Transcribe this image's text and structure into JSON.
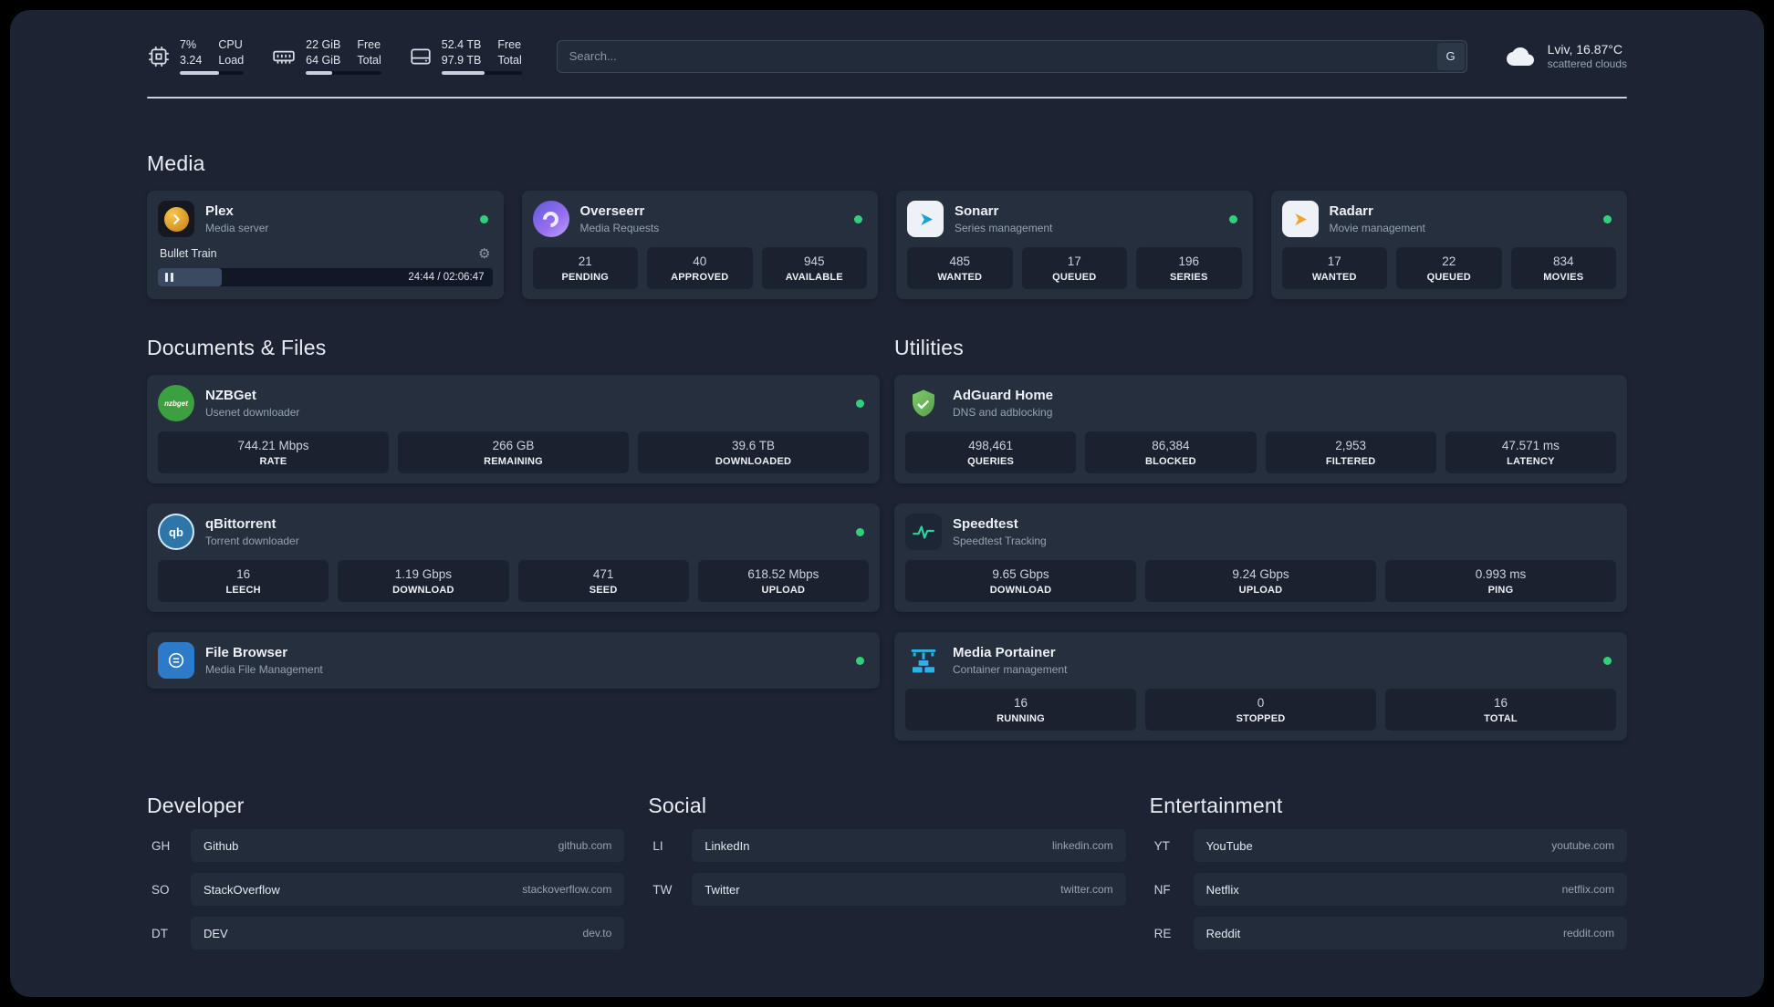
{
  "colors": {
    "status_green": "#31d07c",
    "adguard_green": "#67b279",
    "portainer_blue": "#2fb0e8",
    "background": "#1c2433",
    "card": "#262f3e"
  },
  "header": {
    "cpu": {
      "icon": "cpu-chip-icon",
      "value1": "7%",
      "label1": "CPU",
      "value2": "3.24",
      "label2": "Load",
      "bar_percent": 62
    },
    "memory": {
      "icon": "memory-icon",
      "value1": "22 GiB",
      "label1": "Free",
      "value2": "64 GiB",
      "label2": "Total",
      "bar_percent": 35
    },
    "disk": {
      "icon": "disk-icon",
      "value1": "52.4 TB",
      "label1": "Free",
      "value2": "97.9 TB",
      "label2": "Total",
      "bar_percent": 54
    },
    "search": {
      "placeholder": "Search...",
      "button_label": "G"
    },
    "weather": {
      "icon": "cloud-icon",
      "location": "Lviv, 16.87°C",
      "condition": "scattered clouds"
    }
  },
  "media": {
    "title": "Media",
    "services": [
      {
        "name": "Plex",
        "subtitle": "Media server",
        "icon": "plex-icon",
        "status": "online",
        "now_playing": {
          "title": "Bullet Train",
          "time": "24:44 / 02:06:47",
          "progress_percent": 19,
          "state": "paused"
        }
      },
      {
        "name": "Overseerr",
        "subtitle": "Media Requests",
        "icon": "overseerr-icon",
        "status": "online",
        "stats": [
          {
            "value": "21",
            "label": "PENDING"
          },
          {
            "value": "40",
            "label": "APPROVED"
          },
          {
            "value": "945",
            "label": "AVAILABLE"
          }
        ]
      },
      {
        "name": "Sonarr",
        "subtitle": "Series management",
        "icon": "sonarr-icon",
        "status": "online",
        "stats": [
          {
            "value": "485",
            "label": "WANTED"
          },
          {
            "value": "17",
            "label": "QUEUED"
          },
          {
            "value": "196",
            "label": "SERIES"
          }
        ]
      },
      {
        "name": "Radarr",
        "subtitle": "Movie management",
        "icon": "radarr-icon",
        "status": "online",
        "stats": [
          {
            "value": "17",
            "label": "WANTED"
          },
          {
            "value": "22",
            "label": "QUEUED"
          },
          {
            "value": "834",
            "label": "MOVIES"
          }
        ]
      }
    ]
  },
  "documents": {
    "title": "Documents & Files",
    "services": [
      {
        "name": "NZBGet",
        "subtitle": "Usenet downloader",
        "icon": "nzbget-icon",
        "status": "online",
        "stats": [
          {
            "value": "744.21 Mbps",
            "label": "RATE"
          },
          {
            "value": "266 GB",
            "label": "REMAINING"
          },
          {
            "value": "39.6 TB",
            "label": "DOWNLOADED"
          }
        ]
      },
      {
        "name": "qBittorrent",
        "subtitle": "Torrent downloader",
        "icon": "qbittorrent-icon",
        "status": "online",
        "stats": [
          {
            "value": "16",
            "label": "LEECH"
          },
          {
            "value": "1.19 Gbps",
            "label": "DOWNLOAD"
          },
          {
            "value": "471",
            "label": "SEED"
          },
          {
            "value": "618.52 Mbps",
            "label": "UPLOAD"
          }
        ]
      },
      {
        "name": "File Browser",
        "subtitle": "Media File Management",
        "icon": "filebrowser-icon",
        "status": "online",
        "stats": []
      }
    ]
  },
  "utilities": {
    "title": "Utilities",
    "services": [
      {
        "name": "AdGuard Home",
        "subtitle": "DNS and adblocking",
        "icon": "adguard-icon",
        "stats": [
          {
            "value": "498,461",
            "label": "QUERIES"
          },
          {
            "value": "86,384",
            "label": "BLOCKED"
          },
          {
            "value": "2,953",
            "label": "FILTERED"
          },
          {
            "value": "47.571 ms",
            "label": "LATENCY"
          }
        ]
      },
      {
        "name": "Speedtest",
        "subtitle": "Speedtest Tracking",
        "icon": "speedtest-icon",
        "stats": [
          {
            "value": "9.65 Gbps",
            "label": "DOWNLOAD"
          },
          {
            "value": "9.24 Gbps",
            "label": "UPLOAD"
          },
          {
            "value": "0.993 ms",
            "label": "PING"
          }
        ]
      },
      {
        "name": "Media Portainer",
        "subtitle": "Container management",
        "icon": "portainer-icon",
        "status": "online",
        "stats": [
          {
            "value": "16",
            "label": "RUNNING"
          },
          {
            "value": "0",
            "label": "STOPPED"
          },
          {
            "value": "16",
            "label": "TOTAL"
          }
        ]
      }
    ]
  },
  "bookmarks": [
    {
      "title": "Developer",
      "links": [
        {
          "abbr": "GH",
          "name": "Github",
          "url": "github.com"
        },
        {
          "abbr": "SO",
          "name": "StackOverflow",
          "url": "stackoverflow.com"
        },
        {
          "abbr": "DT",
          "name": "DEV",
          "url": "dev.to"
        }
      ]
    },
    {
      "title": "Social",
      "links": [
        {
          "abbr": "LI",
          "name": "LinkedIn",
          "url": "linkedin.com"
        },
        {
          "abbr": "TW",
          "name": "Twitter",
          "url": "twitter.com"
        }
      ]
    },
    {
      "title": "Entertainment",
      "links": [
        {
          "abbr": "YT",
          "name": "YouTube",
          "url": "youtube.com"
        },
        {
          "abbr": "NF",
          "name": "Netflix",
          "url": "netflix.com"
        },
        {
          "abbr": "RE",
          "name": "Reddit",
          "url": "reddit.com"
        }
      ]
    }
  ]
}
